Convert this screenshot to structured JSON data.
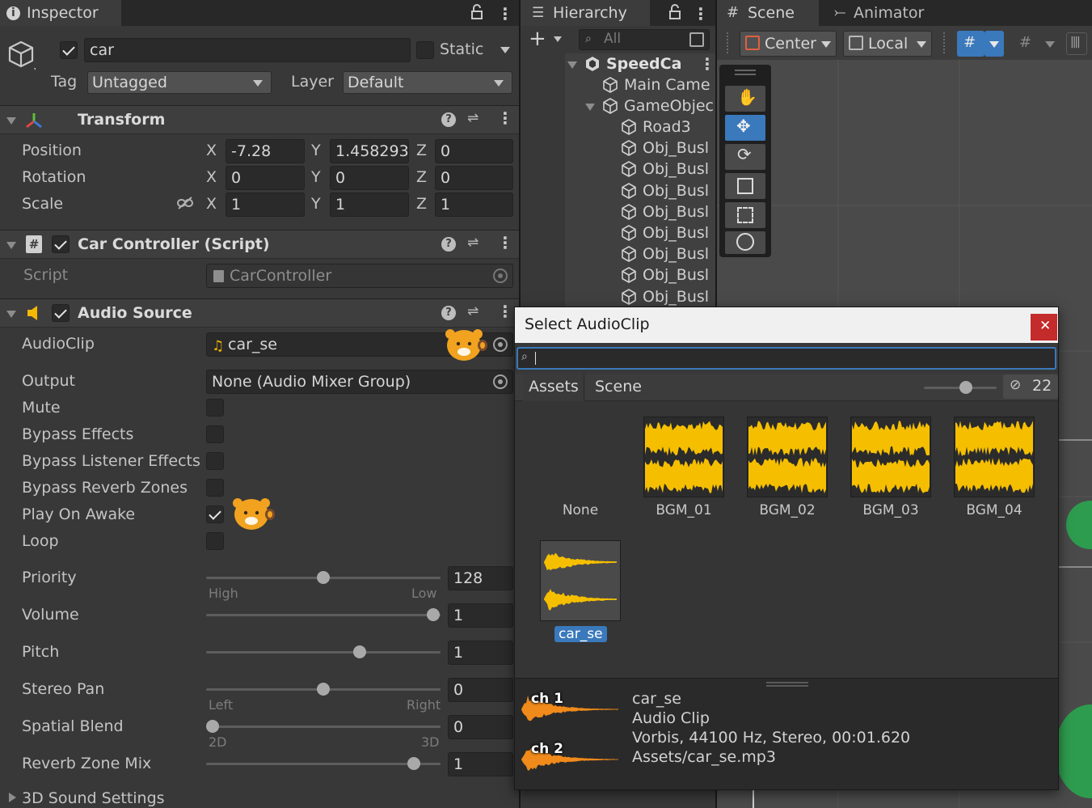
{
  "inspector": {
    "tab_label": "Inspector",
    "object_name": "car",
    "static_label": "Static",
    "tag_label": "Tag",
    "tag_value": "Untagged",
    "layer_label": "Layer",
    "layer_value": "Default",
    "transform": {
      "title": "Transform",
      "position_label": "Position",
      "rotation_label": "Rotation",
      "scale_label": "Scale",
      "axis_x": "X",
      "axis_y": "Y",
      "axis_z": "Z",
      "position": {
        "x": "-7.28",
        "y": "1.458293",
        "z": "0"
      },
      "rotation": {
        "x": "0",
        "y": "0",
        "z": "0"
      },
      "scale": {
        "x": "1",
        "y": "1",
        "z": "1"
      }
    },
    "car_controller": {
      "title": "Car Controller (Script)",
      "script_label": "Script",
      "script_value": "CarController"
    },
    "audio_source": {
      "title": "Audio Source",
      "audioclip_label": "AudioClip",
      "audioclip_value": "car_se",
      "output_label": "Output",
      "output_value": "None (Audio Mixer Group)",
      "mute_label": "Mute",
      "bypass_effects_label": "Bypass Effects",
      "bypass_listener_label": "Bypass Listener Effects",
      "bypass_reverb_label": "Bypass Reverb Zones",
      "play_on_awake_label": "Play On Awake",
      "loop_label": "Loop",
      "priority_label": "Priority",
      "priority_value": "128",
      "priority_high": "High",
      "priority_low": "Low",
      "volume_label": "Volume",
      "volume_value": "1",
      "pitch_label": "Pitch",
      "pitch_value": "1",
      "stereo_pan_label": "Stereo Pan",
      "stereo_pan_value": "0",
      "pan_left": "Left",
      "pan_right": "Right",
      "spatial_blend_label": "Spatial Blend",
      "spatial_blend_value": "0",
      "blend_2d": "2D",
      "blend_3d": "3D",
      "reverb_mix_label": "Reverb Zone Mix",
      "reverb_mix_value": "1",
      "sound_3d_label": "3D Sound Settings"
    }
  },
  "hierarchy": {
    "tab_label": "Hierarchy",
    "search_placeholder": "All",
    "rows": [
      {
        "label": "SpeedCa"
      },
      {
        "label": "Main Came"
      },
      {
        "label": "GameObjec"
      },
      {
        "label": "Road3"
      },
      {
        "label": "Obj_Busl"
      },
      {
        "label": "Obj_Busl"
      },
      {
        "label": "Obj_Busl"
      },
      {
        "label": "Obj_Busl"
      },
      {
        "label": "Obj_Busl"
      },
      {
        "label": "Obj_Busl"
      },
      {
        "label": "Obj_Busl"
      },
      {
        "label": "Obj_Busl"
      }
    ]
  },
  "scene": {
    "tab_scene": "Scene",
    "tab_animator": "Animator",
    "pivot_label": "Center",
    "space_label": "Local"
  },
  "popup": {
    "title": "Select AudioClip",
    "tab_assets": "Assets",
    "tab_scene": "Scene",
    "hidden_count": "22",
    "items": [
      {
        "label": "None"
      },
      {
        "label": "BGM_01"
      },
      {
        "label": "BGM_02"
      },
      {
        "label": "BGM_03"
      },
      {
        "label": "BGM_04"
      },
      {
        "label": "car_se"
      }
    ],
    "preview": {
      "ch1": "ch 1",
      "ch2": "ch 2",
      "name": "car_se",
      "type": "Audio Clip",
      "format": "Vorbis, 44100 Hz, Stereo, 00:01.620",
      "path": "Assets/car_se.mp3"
    }
  },
  "colors": {
    "accent": "#3a79bb",
    "waveform": "#f5bf00",
    "preview_wave": "#f08a1a",
    "close": "#c42b2b"
  }
}
